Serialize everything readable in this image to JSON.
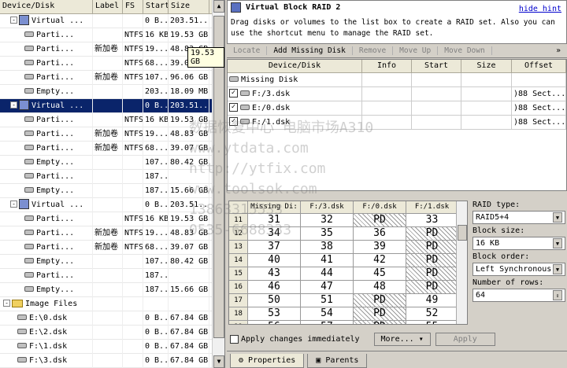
{
  "left_tree": {
    "headers": [
      "Device/Disk",
      "Label",
      "FS",
      "Start",
      "Size"
    ],
    "rows": [
      {
        "name": "Virtual ...",
        "label": "",
        "fs": "",
        "start": "0 B...",
        "size": "203.51...",
        "type": "vdisk",
        "indent": 1,
        "exp": "-"
      },
      {
        "name": "Parti...",
        "label": "",
        "fs": "NTFS",
        "start": "16 KB",
        "size": "19.53 GB",
        "type": "disk",
        "indent": 3
      },
      {
        "name": "Parti...",
        "label": "新加卷",
        "fs": "NTFS",
        "start": "19...",
        "size": "48.83 GB",
        "type": "disk",
        "indent": 3
      },
      {
        "name": "Parti...",
        "label": "",
        "fs": "NTFS",
        "start": "68....",
        "size": "39.07 GB",
        "type": "disk",
        "indent": 3
      },
      {
        "name": "Parti...",
        "label": "新加卷",
        "fs": "NTFS",
        "start": "107...",
        "size": "96.06 GB",
        "type": "disk",
        "indent": 3
      },
      {
        "name": "Empty...",
        "label": "",
        "fs": "",
        "start": "203...",
        "size": "18.09 MB",
        "type": "disk",
        "indent": 3
      },
      {
        "name": "Virtual ...",
        "label": "",
        "fs": "",
        "start": "0 B...",
        "size": "203.51...",
        "type": "vdisk",
        "indent": 1,
        "exp": "-",
        "selected": true
      },
      {
        "name": "Parti...",
        "label": "",
        "fs": "NTFS",
        "start": "16 KB",
        "size": "19.53 GB",
        "type": "disk",
        "indent": 3
      },
      {
        "name": "Parti...",
        "label": "新加卷",
        "fs": "NTFS",
        "start": "19...",
        "size": "48.83 GB",
        "type": "disk",
        "indent": 3
      },
      {
        "name": "Parti...",
        "label": "新加卷",
        "fs": "NTFS",
        "start": "68....",
        "size": "39.07 GB",
        "type": "disk",
        "indent": 3
      },
      {
        "name": "Empty...",
        "label": "",
        "fs": "",
        "start": "107...",
        "size": "80.42 GB",
        "type": "disk",
        "indent": 3
      },
      {
        "name": "Parti...",
        "label": "",
        "fs": "",
        "start": "187...",
        "size": "",
        "type": "disk",
        "indent": 3
      },
      {
        "name": "Empty...",
        "label": "",
        "fs": "",
        "start": "187...",
        "size": "15.66 GB",
        "type": "disk",
        "indent": 3
      },
      {
        "name": "Virtual ...",
        "label": "",
        "fs": "",
        "start": "0 B...",
        "size": "203.51...",
        "type": "vdisk",
        "indent": 1,
        "exp": "-"
      },
      {
        "name": "Parti...",
        "label": "",
        "fs": "NTFS",
        "start": "16 KB",
        "size": "19.53 GB",
        "type": "disk",
        "indent": 3
      },
      {
        "name": "Parti...",
        "label": "新加卷",
        "fs": "NTFS",
        "start": "19...",
        "size": "48.83 GB",
        "type": "disk",
        "indent": 3
      },
      {
        "name": "Parti...",
        "label": "新加卷",
        "fs": "NTFS",
        "start": "68....",
        "size": "39.07 GB",
        "type": "disk",
        "indent": 3
      },
      {
        "name": "Empty...",
        "label": "",
        "fs": "",
        "start": "107...",
        "size": "80.42 GB",
        "type": "disk",
        "indent": 3
      },
      {
        "name": "Parti...",
        "label": "",
        "fs": "",
        "start": "187...",
        "size": "",
        "type": "disk",
        "indent": 3
      },
      {
        "name": "Empty...",
        "label": "",
        "fs": "",
        "start": "187...",
        "size": "15.66 GB",
        "type": "disk",
        "indent": 3
      },
      {
        "name": "Image Files",
        "label": "",
        "fs": "",
        "start": "",
        "size": "",
        "type": "folder",
        "indent": 0,
        "exp": "-"
      },
      {
        "name": "E:\\0.dsk",
        "label": "",
        "fs": "",
        "start": "0 B...",
        "size": "67.84 GB",
        "type": "disk",
        "indent": 2
      },
      {
        "name": "E:\\2.dsk",
        "label": "",
        "fs": "",
        "start": "0 B...",
        "size": "67.84 GB",
        "type": "disk",
        "indent": 2
      },
      {
        "name": "F:\\1.dsk",
        "label": "",
        "fs": "",
        "start": "0 B...",
        "size": "67.84 GB",
        "type": "disk",
        "indent": 2
      },
      {
        "name": "F:\\3.dsk",
        "label": "",
        "fs": "",
        "start": "0 B...",
        "size": "67.84 GB",
        "type": "disk",
        "indent": 2
      }
    ],
    "tooltip": "19.53 GB"
  },
  "hint": {
    "title": "Virtual Block RAID 2",
    "hide": "hide hint",
    "desc": "Drag disks or volumes to the list box to create a RAID set. Also you can use the shortcut menu to manage the RAID set."
  },
  "toolbar": [
    {
      "label": "Locate",
      "enabled": false
    },
    {
      "label": "Add Missing Disk",
      "enabled": true
    },
    {
      "label": "Remove",
      "enabled": false
    },
    {
      "label": "Move Up",
      "enabled": false
    },
    {
      "label": "Move Down",
      "enabled": false
    }
  ],
  "toolbar_more": "»",
  "raid_table": {
    "headers": [
      "Device/Disk",
      "Info",
      "Start",
      "Size",
      "Offset"
    ],
    "rows": [
      {
        "name": "Missing Disk",
        "checkbox": false,
        "offset": ""
      },
      {
        "name": "F:/3.dsk",
        "checkbox": true,
        "offset": ")88 Sect..."
      },
      {
        "name": "E:/0.dsk",
        "checkbox": true,
        "offset": ")88 Sect..."
      },
      {
        "name": "F:/1.dsk",
        "checkbox": true,
        "offset": ")88 Sect..."
      }
    ]
  },
  "grid": {
    "headers": [
      "",
      "Missing Di:",
      "F:/3.dsk",
      "F:/0.dsk",
      "F:/1.dsk"
    ],
    "rows": [
      [
        "11",
        "31",
        "32",
        "PD",
        "33"
      ],
      [
        "12",
        "34",
        "35",
        "36",
        "PD"
      ],
      [
        "13",
        "37",
        "38",
        "39",
        "PD"
      ],
      [
        "14",
        "40",
        "41",
        "42",
        "PD"
      ],
      [
        "15",
        "43",
        "44",
        "45",
        "PD"
      ],
      [
        "16",
        "46",
        "47",
        "48",
        "PD"
      ],
      [
        "17",
        "50",
        "51",
        "PD",
        "49"
      ],
      [
        "18",
        "53",
        "54",
        "PD",
        "52"
      ],
      [
        "19",
        "56",
        "57",
        "PD",
        "55"
      ]
    ]
  },
  "props": {
    "raid_type_label": "RAID type:",
    "raid_type": "RAID5+4",
    "block_size_label": "Block size:",
    "block_size": "16 KB",
    "block_order_label": "Block order:",
    "block_order": "Left Synchronous",
    "rows_label": "Number of rows:",
    "rows": "64"
  },
  "bottom": {
    "apply_immediately": "Apply changes immediately",
    "more": "More...",
    "apply": "Apply"
  },
  "tabs": [
    "Properties",
    "Parents"
  ],
  "watermark": [
    "数据恢复中心 电脑市场A310",
    "www.ytdata.com",
    "http://ytfix.com",
    "www.toolsok.com",
    "13863315533",
    "0535-6688333"
  ]
}
